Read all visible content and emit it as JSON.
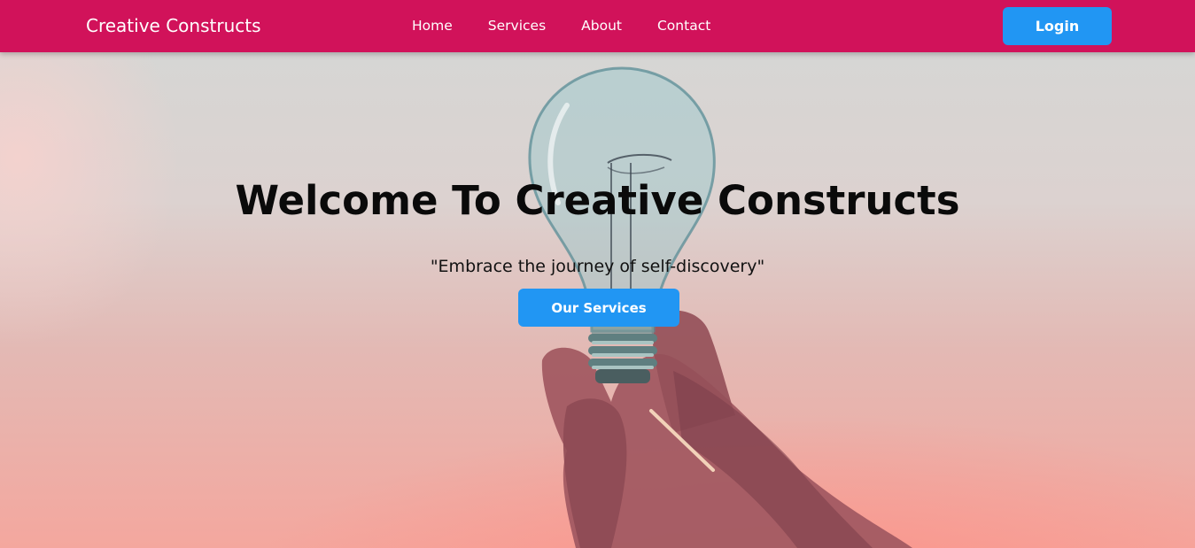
{
  "colors": {
    "navbar_bg": "#d1125a",
    "button_bg": "#2196f3",
    "nav_text": "#ffffff"
  },
  "navbar": {
    "brand": "Creative Constructs",
    "links": [
      {
        "label": "Home"
      },
      {
        "label": "Services"
      },
      {
        "label": "About"
      },
      {
        "label": "Contact"
      }
    ],
    "login_label": "Login"
  },
  "hero": {
    "background_image": "hand-holding-light-bulb-photo",
    "title": "Welcome To Creative Constructs",
    "quote": "\"Embrace the journey of self-discovery\"",
    "cta_label": "Our Services"
  }
}
